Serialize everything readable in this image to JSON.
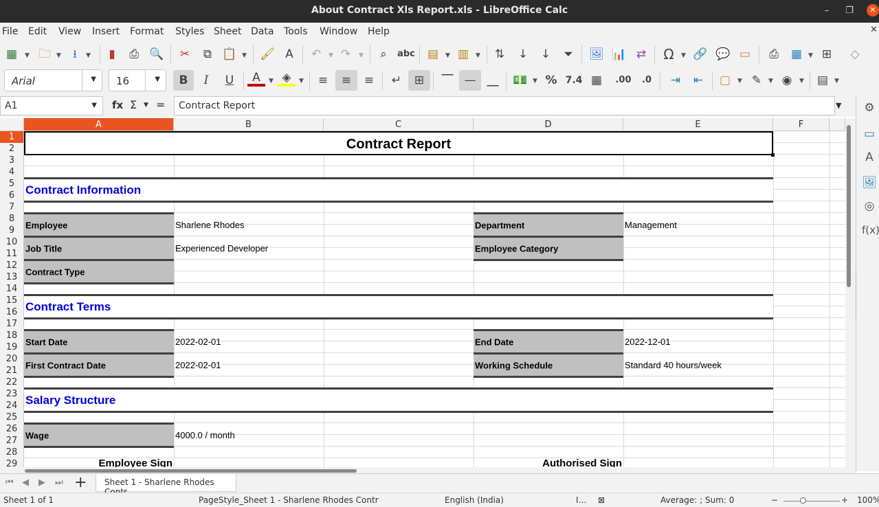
{
  "window": {
    "title": "About Contract Xls Report.xls - LibreOffice Calc"
  },
  "menu": [
    "File",
    "Edit",
    "View",
    "Insert",
    "Format",
    "Styles",
    "Sheet",
    "Data",
    "Tools",
    "Window",
    "Help"
  ],
  "toolbar2": {
    "font_name": "Arial",
    "font_size": "16"
  },
  "formula_bar": {
    "cell_ref": "A1",
    "fx": "fx",
    "sigma": "Σ",
    "equals": "=",
    "content": "Contract Report"
  },
  "columns": [
    "A",
    "B",
    "C",
    "D",
    "E",
    "F"
  ],
  "rows": [
    "1",
    "2",
    "3",
    "4",
    "5",
    "6",
    "7",
    "8",
    "9",
    "10",
    "11",
    "12",
    "13",
    "14",
    "15",
    "16",
    "17",
    "18",
    "19",
    "20",
    "21",
    "22",
    "23",
    "24",
    "25",
    "26",
    "27",
    "28",
    "29"
  ],
  "sheet": {
    "title": "Contract Report",
    "contract_information": {
      "heading": "Contract Information",
      "employee_label": "Employee",
      "employee_value": "Sharlene Rhodes",
      "department_label": "Department",
      "department_value": "Management",
      "job_title_label": "Job Title",
      "job_title_value": "Experienced Developer",
      "employee_category_label": "Employee Category",
      "contract_type_label": "Contract Type"
    },
    "contract_terms": {
      "heading": "Contract Terms",
      "start_date_label": "Start Date",
      "start_date_value": "2022-02-01",
      "end_date_label": "End Date",
      "end_date_value": "2022-12-01",
      "first_contract_label": "First Contract Date",
      "first_contract_value": "2022-02-01",
      "working_schedule_label": "Working Schedule",
      "working_schedule_value": "Standard 40 hours/week"
    },
    "salary": {
      "heading": "Salary Structure",
      "wage_label": "Wage",
      "wage_value": "4000.0 / month",
      "employee_sign": "Employee Sign",
      "authorised_sign": "Authorised Sign"
    }
  },
  "tabs": {
    "add": "+",
    "sheet1": "Sheet 1 - Sharlene Rhodes Contr"
  },
  "status": {
    "sheet_of": "Sheet 1 of 1",
    "page_style": "PageStyle_Sheet 1 - Sharlene Rhodes Contr",
    "language": "English (India)",
    "summary": "Average: ; Sum: 0",
    "zoom": "100%"
  },
  "colors": {
    "accent": "#e95420",
    "section_blue": "#0000dd",
    "label_grey": "#c0c0c0"
  }
}
